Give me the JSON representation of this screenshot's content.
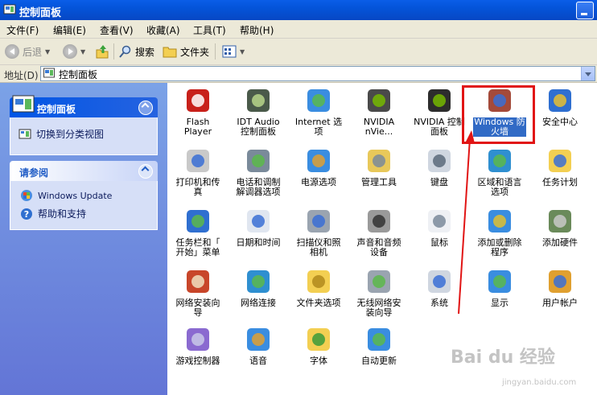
{
  "window": {
    "title": "控制面板"
  },
  "menu": [
    "文件(F)",
    "编辑(E)",
    "查看(V)",
    "收藏(A)",
    "工具(T)",
    "帮助(H)"
  ],
  "toolbar": {
    "back": "后退",
    "search": "搜索",
    "folders": "文件夹"
  },
  "address": {
    "label": "地址(D)",
    "value": "控制面板"
  },
  "sidebar": {
    "panel1": {
      "title": "控制面板",
      "link": "切换到分类视图"
    },
    "panel2": {
      "title": "请参阅",
      "links": [
        "Windows Update",
        "帮助和支持"
      ]
    }
  },
  "items": [
    {
      "label": "Flash\nPlayer",
      "icon": "flash-icon"
    },
    {
      "label": "IDT Audio\n控制面板",
      "icon": "audio-icon"
    },
    {
      "label": "Internet 选\n项",
      "icon": "internet-options-icon"
    },
    {
      "label": "NVIDIA\nnVie...",
      "icon": "nvidia-icon"
    },
    {
      "label": "NVIDIA 控制\n面板",
      "icon": "nvidia-panel-icon"
    },
    {
      "label": "Windows 防\n火墙",
      "icon": "firewall-icon"
    },
    {
      "label": "安全中心",
      "icon": "security-center-icon"
    },
    {
      "label": "打印机和传\n真",
      "icon": "printer-icon"
    },
    {
      "label": "电话和调制\n解调器选项",
      "icon": "phone-modem-icon"
    },
    {
      "label": "电源选项",
      "icon": "power-icon"
    },
    {
      "label": "管理工具",
      "icon": "admin-tools-icon"
    },
    {
      "label": "键盘",
      "icon": "keyboard-icon"
    },
    {
      "label": "区域和语言\n选项",
      "icon": "region-icon"
    },
    {
      "label": "任务计划",
      "icon": "scheduled-tasks-icon"
    },
    {
      "label": "任务栏和「\n开始」菜单",
      "icon": "taskbar-icon"
    },
    {
      "label": "日期和时间",
      "icon": "datetime-icon"
    },
    {
      "label": "扫描仪和照\n相机",
      "icon": "scanner-icon"
    },
    {
      "label": "声音和音频\n设备",
      "icon": "sound-icon"
    },
    {
      "label": "鼠标",
      "icon": "mouse-icon"
    },
    {
      "label": "添加或删除\n程序",
      "icon": "add-remove-icon"
    },
    {
      "label": "添加硬件",
      "icon": "add-hardware-icon"
    },
    {
      "label": "网络安装向\n导",
      "icon": "network-setup-icon"
    },
    {
      "label": "网络连接",
      "icon": "network-connections-icon"
    },
    {
      "label": "文件夹选项",
      "icon": "folder-options-icon"
    },
    {
      "label": "无线网络安\n装向导",
      "icon": "wireless-icon"
    },
    {
      "label": "系统",
      "icon": "system-icon"
    },
    {
      "label": "显示",
      "icon": "display-icon"
    },
    {
      "label": "用户帐户",
      "icon": "user-accounts-icon"
    },
    {
      "label": "游戏控制器",
      "icon": "game-controllers-icon"
    },
    {
      "label": "语音",
      "icon": "speech-icon"
    },
    {
      "label": "字体",
      "icon": "fonts-icon"
    },
    {
      "label": "自动更新",
      "icon": "auto-update-icon"
    }
  ],
  "watermark": {
    "text": "Bai du 经验",
    "sub": "jingyan.baidu.com"
  },
  "colors": {
    "titlebar": "#0454d9",
    "sidebar": "#6f8be0",
    "selection": "#316ac5",
    "highlight_box": "#e11414"
  }
}
